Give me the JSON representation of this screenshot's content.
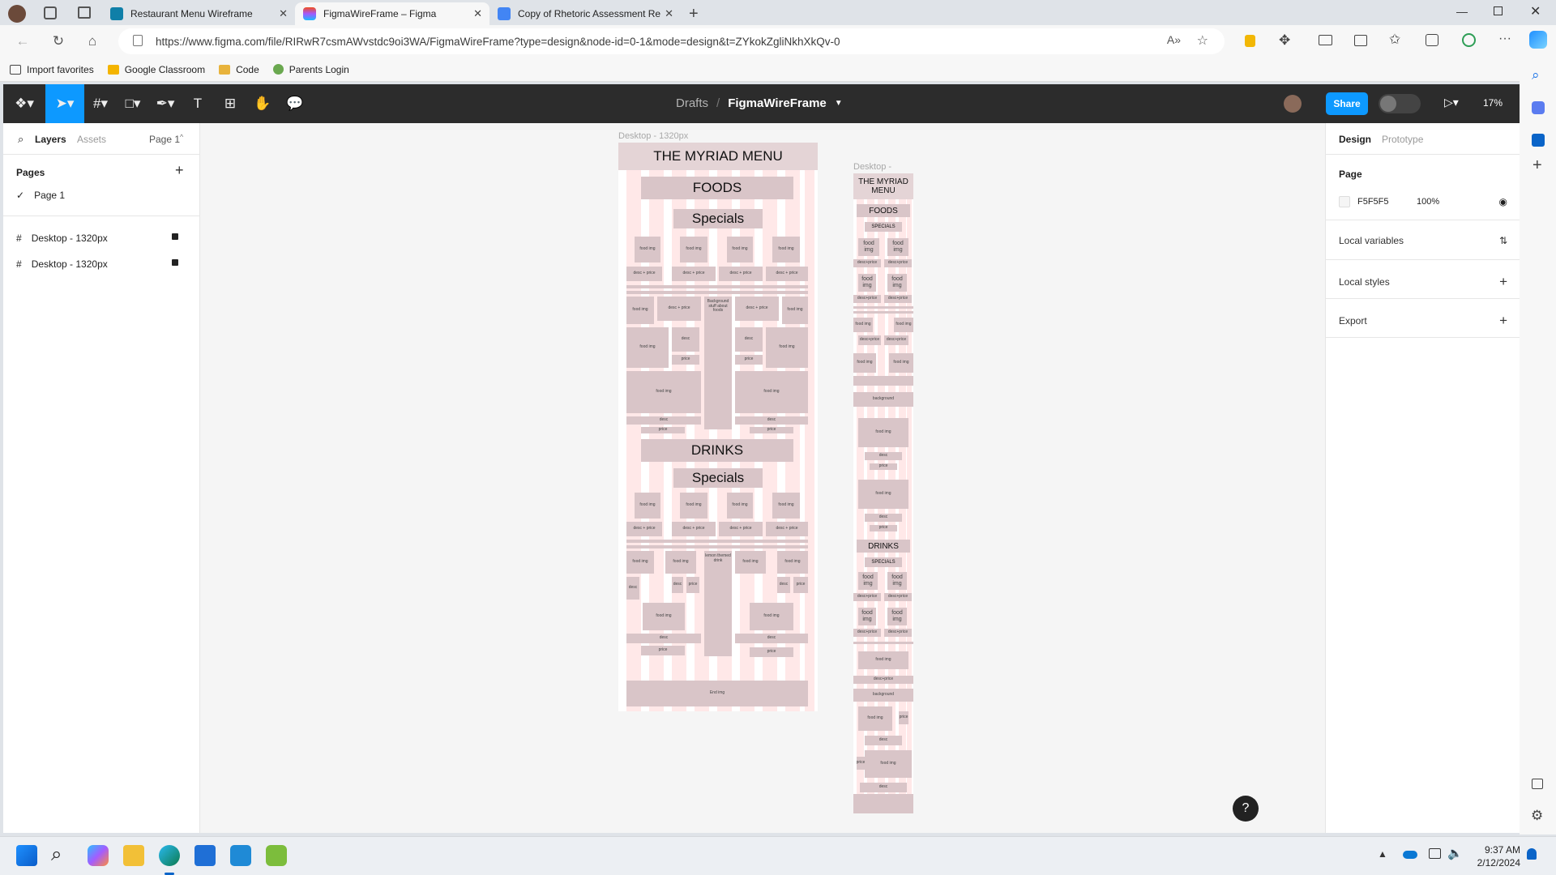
{
  "browser": {
    "tabs": [
      {
        "title": "Restaurant Menu Wireframe",
        "icon": "classroom-icon",
        "color": "#0f7fa8"
      },
      {
        "title": "FigmaWireFrame – Figma",
        "icon": "figma-icon",
        "color": "#f24e1e",
        "active": true
      },
      {
        "title": "Copy of Rhetoric Assessment Re",
        "icon": "docs-icon",
        "color": "#4285f4"
      }
    ],
    "url": "https://www.figma.com/file/RIRwR7csmAWvstdc9oi3WA/FigmaWireFrame?type=design&node-id=0-1&mode=design&t=ZYkokZgliNkhXkQv-0",
    "favorites": [
      "Import favorites",
      "Google Classroom",
      "Code",
      "Parents Login"
    ]
  },
  "figma": {
    "breadcrumb_parent": "Drafts",
    "file_name": "FigmaWireFrame",
    "share_label": "Share",
    "zoom": "17%",
    "left": {
      "tab_layers": "Layers",
      "tab_assets": "Assets",
      "page_selector": "Page 1",
      "pages_heading": "Pages",
      "pages": [
        "Page 1"
      ],
      "layers": [
        "Desktop - 1320px",
        "Desktop - 1320px"
      ]
    },
    "right": {
      "tab_design": "Design",
      "tab_prototype": "Prototype",
      "page_heading": "Page",
      "bg_hex": "F5F5F5",
      "bg_opacity": "100%",
      "local_variables": "Local variables",
      "local_styles": "Local styles",
      "export": "Export"
    },
    "canvas": {
      "frame1_label": "Desktop - 1320px",
      "frame2_label": "Desktop -",
      "frame1": {
        "title": "THE MYRIAD MENU",
        "foods": "FOODS",
        "specials": "Specials",
        "drinks": "DRINKS",
        "specials2": "Specials",
        "food_img": "food img",
        "desc_price": "desc + price",
        "desc": "desc",
        "price": "price",
        "bg_food": "Background stuff about foods",
        "bg_drink": "lemon themed drink",
        "end_img": "End img"
      },
      "frame2": {
        "title": "THE MYRIAD MENU",
        "foods": "FOODS",
        "specials": "SPECIALS",
        "drinks": "DRINKS",
        "specials2": "SPECIALS",
        "food_img": "food img",
        "desc_price": "desc+price",
        "background": "background",
        "desc": "desc",
        "price": "price"
      }
    }
  },
  "taskbar": {
    "time": "9:37 AM",
    "date": "2/12/2024"
  }
}
